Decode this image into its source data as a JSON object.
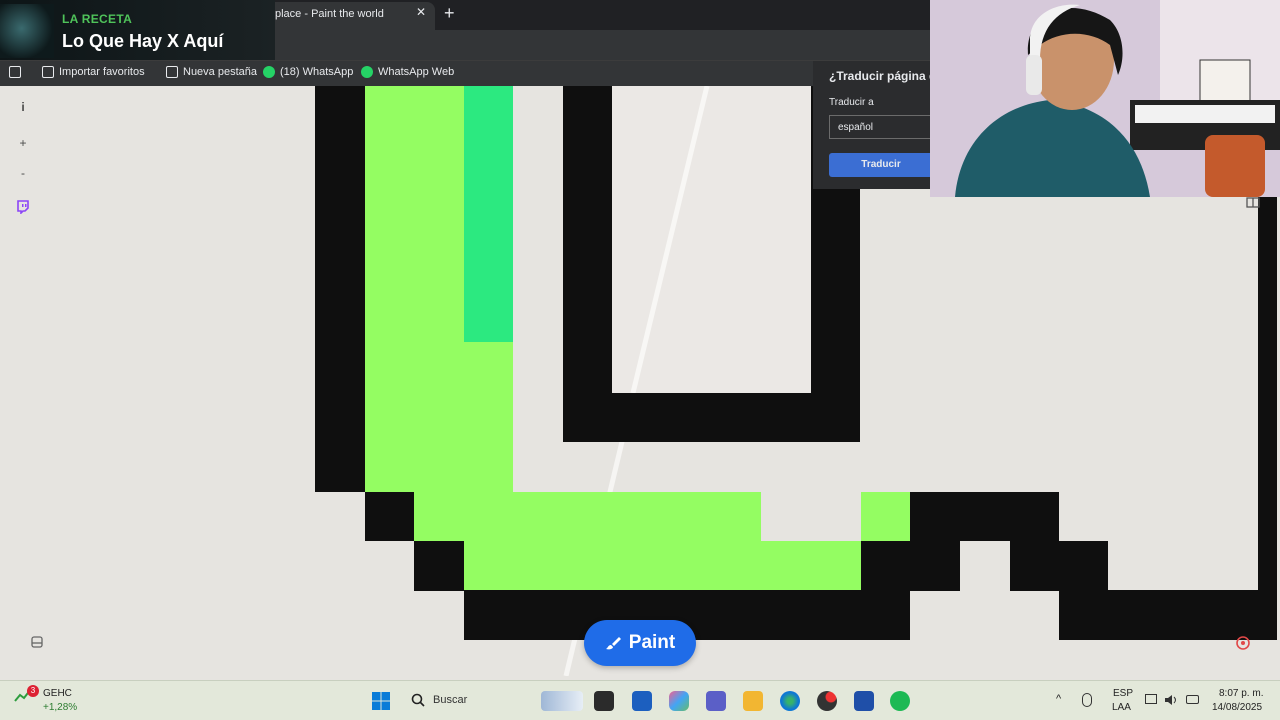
{
  "overlay": {
    "subtitle": "LA RECETA",
    "title": "Lo Que Hay X Aquí"
  },
  "browser": {
    "tab_title": "place - Paint the world",
    "tab_close": "✕",
    "new_tab": "+",
    "bookmarks": [
      {
        "label": "Importar favoritos",
        "icon": "import-icon"
      },
      {
        "label": "Nueva pestaña",
        "icon": "page-icon"
      },
      {
        "label": "(18) WhatsApp",
        "icon": "whatsapp-icon"
      },
      {
        "label": "WhatsApp Web",
        "icon": "whatsapp-icon"
      }
    ]
  },
  "map_tools": {
    "info": "i",
    "zoom_in": "+",
    "zoom_out": "-"
  },
  "paint_button": {
    "label": "Paint",
    "color": "#1f6ce8"
  },
  "translate": {
    "title": "¿Traducir página d",
    "label": "Traducir a",
    "language": "español",
    "button": "Traducir"
  },
  "taskbar": {
    "stock_badge": "3",
    "stock_name": "GEHC",
    "stock_change": "+1,28%",
    "search_placeholder": "Buscar",
    "lang_top": "ESP",
    "lang_bottom": "LAA",
    "time": "8:07 p. m.",
    "date": "14/08/2025"
  },
  "colors": {
    "black": "#0f0f0f",
    "lime": "#94fd62",
    "mint": "#2ce980",
    "canvas": "#e6e4e0",
    "inner_white": "#ebe8e5"
  }
}
